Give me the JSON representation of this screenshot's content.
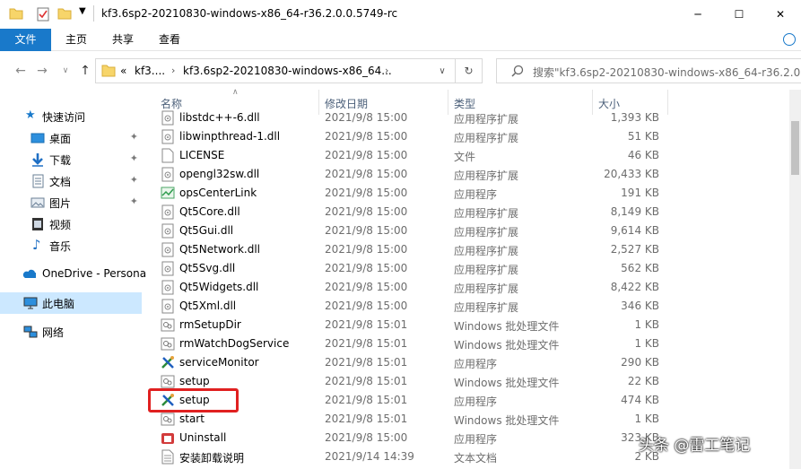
{
  "window": {
    "title": "kf3.6sp2-20210830-windows-x86_64-r36.2.0.0.5749-rc",
    "controls": {
      "minimize": "─",
      "maximize": "☐",
      "close": "✕"
    }
  },
  "ribbon": {
    "tabs": [
      "文件",
      "主页",
      "共享",
      "查看"
    ]
  },
  "address": {
    "overflow": "«",
    "crumbs": [
      "kf3....",
      "kf3.6sp2-20210830-windows-x86_64..."
    ],
    "search_placeholder": "搜索\"kf3.6sp2-20210830-windows-x86_64-r36.2.0...."
  },
  "nav": {
    "items": [
      {
        "label": "快速访问",
        "icon": "star-icon"
      },
      {
        "label": "桌面",
        "icon": "desktop-icon",
        "pinned": true
      },
      {
        "label": "下载",
        "icon": "download-icon",
        "pinned": true
      },
      {
        "label": "文档",
        "icon": "document-icon",
        "pinned": true
      },
      {
        "label": "图片",
        "icon": "picture-icon",
        "pinned": true
      },
      {
        "label": "视频",
        "icon": "video-icon"
      },
      {
        "label": "音乐",
        "icon": "music-icon"
      },
      {
        "label": "OneDrive - Persona",
        "icon": "cloud-icon"
      },
      {
        "label": "此电脑",
        "icon": "computer-icon",
        "selected": true
      },
      {
        "label": "网络",
        "icon": "network-icon"
      }
    ]
  },
  "columns": {
    "name": "名称",
    "date": "修改日期",
    "type": "类型",
    "size": "大小"
  },
  "files": [
    {
      "name": "libstdc++-6.dll",
      "date": "2021/9/8 15:00",
      "type": "应用程序扩展",
      "size": "1,393 KB",
      "icon": "dll"
    },
    {
      "name": "libwinpthread-1.dll",
      "date": "2021/9/8 15:00",
      "type": "应用程序扩展",
      "size": "51 KB",
      "icon": "dll"
    },
    {
      "name": "LICENSE",
      "date": "2021/9/8 15:00",
      "type": "文件",
      "size": "46 KB",
      "icon": "file"
    },
    {
      "name": "opengl32sw.dll",
      "date": "2021/9/8 15:00",
      "type": "应用程序扩展",
      "size": "20,433 KB",
      "icon": "dll"
    },
    {
      "name": "opsCenterLink",
      "date": "2021/9/8 15:00",
      "type": "应用程序",
      "size": "191 KB",
      "icon": "chart-app"
    },
    {
      "name": "Qt5Core.dll",
      "date": "2021/9/8 15:00",
      "type": "应用程序扩展",
      "size": "8,149 KB",
      "icon": "dll"
    },
    {
      "name": "Qt5Gui.dll",
      "date": "2021/9/8 15:00",
      "type": "应用程序扩展",
      "size": "9,614 KB",
      "icon": "dll"
    },
    {
      "name": "Qt5Network.dll",
      "date": "2021/9/8 15:00",
      "type": "应用程序扩展",
      "size": "2,527 KB",
      "icon": "dll"
    },
    {
      "name": "Qt5Svg.dll",
      "date": "2021/9/8 15:00",
      "type": "应用程序扩展",
      "size": "562 KB",
      "icon": "dll"
    },
    {
      "name": "Qt5Widgets.dll",
      "date": "2021/9/8 15:00",
      "type": "应用程序扩展",
      "size": "8,422 KB",
      "icon": "dll"
    },
    {
      "name": "Qt5Xml.dll",
      "date": "2021/9/8 15:00",
      "type": "应用程序扩展",
      "size": "346 KB",
      "icon": "dll"
    },
    {
      "name": "rmSetupDir",
      "date": "2021/9/8 15:01",
      "type": "Windows 批处理文件",
      "size": "1 KB",
      "icon": "bat"
    },
    {
      "name": "rmWatchDogService",
      "date": "2021/9/8 15:01",
      "type": "Windows 批处理文件",
      "size": "1 KB",
      "icon": "bat"
    },
    {
      "name": "serviceMonitor",
      "date": "2021/9/8 15:01",
      "type": "应用程序",
      "size": "290 KB",
      "icon": "tools-app"
    },
    {
      "name": "setup",
      "date": "2021/9/8 15:01",
      "type": "Windows 批处理文件",
      "size": "22 KB",
      "icon": "bat"
    },
    {
      "name": "setup",
      "date": "2021/9/8 15:01",
      "type": "应用程序",
      "size": "474 KB",
      "icon": "tools-app"
    },
    {
      "name": "start",
      "date": "2021/9/8 15:01",
      "type": "Windows 批处理文件",
      "size": "1 KB",
      "icon": "bat"
    },
    {
      "name": "Uninstall",
      "date": "2021/9/8 15:00",
      "type": "应用程序",
      "size": "323 KB",
      "icon": "uninstall-app"
    },
    {
      "name": "安装卸载说明",
      "date": "2021/9/14 14:39",
      "type": "文本文档",
      "size": "2 KB",
      "icon": "txt"
    }
  ],
  "watermark": "头条 @雷工笔记",
  "colors": {
    "accent": "#1979ca",
    "selected_bg": "#cce8ff",
    "highlight_box": "#e02020"
  }
}
